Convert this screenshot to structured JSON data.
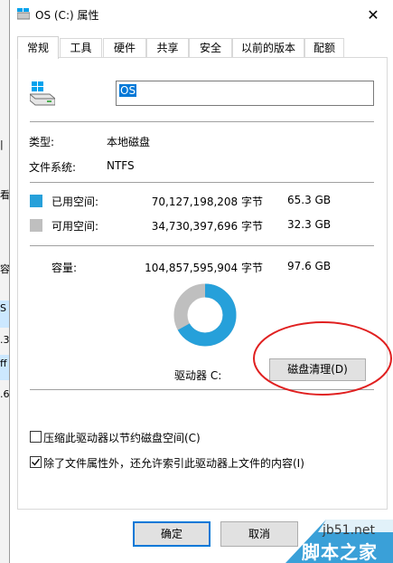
{
  "window": {
    "title": "OS (C:) 属性",
    "close_glyph": "✕"
  },
  "tabs": [
    {
      "label": "常规"
    },
    {
      "label": "工具"
    },
    {
      "label": "硬件"
    },
    {
      "label": "共享"
    },
    {
      "label": "安全"
    },
    {
      "label": "以前的版本"
    },
    {
      "label": "配额"
    }
  ],
  "general": {
    "drive_name": "OS",
    "type_label": "类型:",
    "type_value": "本地磁盘",
    "fs_label": "文件系统:",
    "fs_value": "NTFS",
    "used": {
      "label": "已用空间:",
      "bytes": "70,127,198,208 字节",
      "size": "65.3 GB",
      "color": "#26a0da"
    },
    "free": {
      "label": "可用空间:",
      "bytes": "34,730,397,696 字节",
      "size": "32.3 GB",
      "color": "#bfbfbf"
    },
    "capacity": {
      "label": "容量:",
      "bytes": "104,857,595,904 字节",
      "size": "97.6 GB"
    },
    "usage_fraction": 0.669,
    "drive_label": "驱动器 C:",
    "cleanup_button": "磁盘清理(D)",
    "compress_checkbox": {
      "label": "压缩此驱动器以节约磁盘空间(C)",
      "checked": false
    },
    "index_checkbox": {
      "label": "除了文件属性外，还允许索引此驱动器上文件的内容(I)",
      "checked": true
    }
  },
  "footer": {
    "ok_button": "确定",
    "cancel_button": "取消"
  },
  "background_window": {
    "fragments": [
      "|",
      "看",
      "容",
      "S",
      ".3",
      "ff",
      ".6"
    ]
  },
  "watermark": {
    "site": "jb51.net",
    "text": "脚本之家"
  },
  "annotation_color": "#e02020"
}
